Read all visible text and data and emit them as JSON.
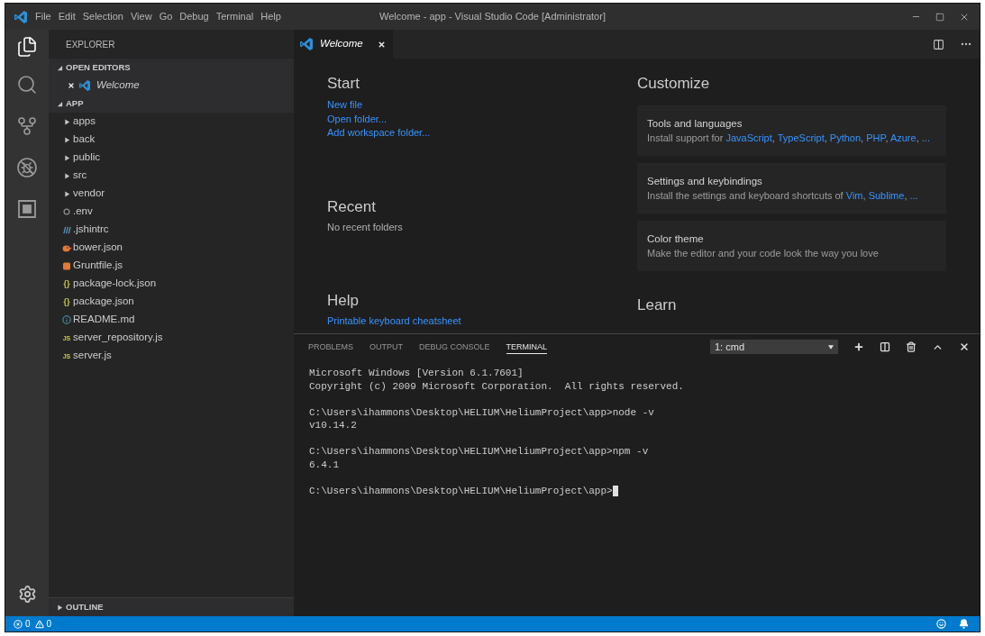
{
  "title_bar": {
    "menu": [
      "File",
      "Edit",
      "Selection",
      "View",
      "Go",
      "Debug",
      "Terminal",
      "Help"
    ],
    "title": "Welcome - app - Visual Studio Code [Administrator]"
  },
  "activity_bar": {
    "items": [
      {
        "selected": true
      },
      {
        "selected": false
      },
      {
        "selected": false
      },
      {
        "selected": false
      },
      {
        "selected": false
      }
    ]
  },
  "sidebar": {
    "title": "EXPLORER",
    "sections": [
      {
        "title": "OPEN EDITORS",
        "expanded": true,
        "items": [
          {
            "name": "Welcome",
            "preview": true
          }
        ]
      },
      {
        "title": "APP",
        "expanded": true,
        "children": [
          {
            "name": "apps",
            "kind": "folder",
            "expanded": false
          },
          {
            "name": "back",
            "kind": "folder",
            "expanded": false
          },
          {
            "name": "public",
            "kind": "folder",
            "expanded": false
          },
          {
            "name": "src",
            "kind": "folder",
            "expanded": false
          },
          {
            "name": "vendor",
            "kind": "folder",
            "expanded": false
          },
          {
            "name": ".env",
            "kind": "env"
          },
          {
            "name": ".jshintrc",
            "kind": "config"
          },
          {
            "name": "bower.json",
            "kind": "bower"
          },
          {
            "name": "Gruntfile.js",
            "kind": "grunt"
          },
          {
            "name": "package-lock.json",
            "kind": "json",
            "icon_text": "{}"
          },
          {
            "name": "package.json",
            "kind": "json",
            "icon_text": "{}"
          },
          {
            "name": "README.md",
            "kind": "info"
          },
          {
            "name": "server_repository.js",
            "kind": "js",
            "icon_text": "JS"
          },
          {
            "name": "server.js",
            "kind": "js",
            "icon_text": "JS"
          }
        ]
      },
      {
        "title": "OUTLINE",
        "expanded": false
      }
    ]
  },
  "editor": {
    "tabs": [
      {
        "label": "Welcome",
        "selected": true,
        "preview": true
      }
    ]
  },
  "welcome": {
    "start": {
      "title": "Start",
      "links": [
        "New file",
        "Open folder...",
        "Add workspace folder..."
      ]
    },
    "recent": {
      "title": "Recent",
      "empty_text": "No recent folders"
    },
    "help": {
      "title": "Help",
      "links": [
        "Printable keyboard cheatsheet"
      ]
    },
    "customize": {
      "title": "Customize",
      "cards": [
        {
          "title": "Tools and languages",
          "description": [
            {
              "kind": "text",
              "text": "Install support for "
            },
            {
              "kind": "link",
              "text": "JavaScript"
            },
            {
              "kind": "text",
              "text": ", "
            },
            {
              "kind": "link",
              "text": "TypeScript"
            },
            {
              "kind": "text",
              "text": ", "
            },
            {
              "kind": "link",
              "text": "Python"
            },
            {
              "kind": "text",
              "text": ", "
            },
            {
              "kind": "link",
              "text": "PHP"
            },
            {
              "kind": "text",
              "text": ", "
            },
            {
              "kind": "link",
              "text": "Azure"
            },
            {
              "kind": "text",
              "text": ", "
            },
            {
              "kind": "link",
              "text": "..."
            }
          ]
        },
        {
          "title": "Settings and keybindings",
          "description": [
            {
              "kind": "text",
              "text": "Install the settings and keyboard shortcuts of "
            },
            {
              "kind": "link",
              "text": "Vim"
            },
            {
              "kind": "text",
              "text": ", "
            },
            {
              "kind": "link",
              "text": "Sublime"
            },
            {
              "kind": "text",
              "text": ", "
            },
            {
              "kind": "link",
              "text": "..."
            }
          ]
        },
        {
          "title": "Color theme",
          "description": [
            {
              "kind": "text",
              "text": "Make the editor and your code look the way you love"
            }
          ]
        }
      ]
    },
    "learn": {
      "title": "Learn"
    }
  },
  "panel": {
    "tabs": [
      {
        "label": "PROBLEMS",
        "selected": false
      },
      {
        "label": "OUTPUT",
        "selected": false
      },
      {
        "label": "DEBUG CONSOLE",
        "selected": false
      },
      {
        "label": "TERMINAL",
        "selected": true
      }
    ],
    "terminal_selector": "1: cmd",
    "terminal": {
      "blocks": [
        [
          "Microsoft Windows [Version 6.1.7601]",
          "Copyright (c) 2009 Microsoft Corporation.  All rights reserved."
        ],
        [
          "C:\\Users\\ihammons\\Desktop\\HELIUM\\HeliumProject\\app>node -v",
          "v10.14.2"
        ],
        [
          "C:\\Users\\ihammons\\Desktop\\HELIUM\\HeliumProject\\app>npm -v",
          "6.4.1"
        ],
        [
          "C:\\Users\\ihammons\\Desktop\\HELIUM\\HeliumProject\\app>"
        ]
      ],
      "cursor": true
    }
  },
  "status_bar": {
    "errors": "0",
    "warnings": "0"
  }
}
